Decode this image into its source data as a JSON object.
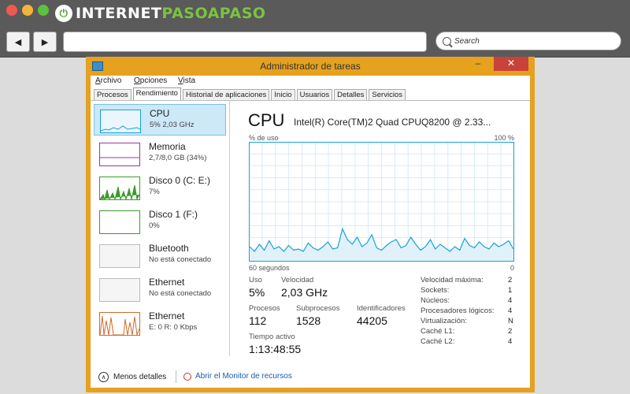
{
  "browser": {
    "brand_prefix": "INTERNET",
    "brand_accent": "PASOAPASO",
    "search_placeholder": "Search",
    "back_glyph": "◀",
    "forward_glyph": "▶"
  },
  "window": {
    "title": "Administrador de tareas",
    "minimize_glyph": "–",
    "close_glyph": "✕"
  },
  "menu": [
    "Archivo",
    "Opciones",
    "Vista"
  ],
  "tabs": [
    "Procesos",
    "Rendimiento",
    "Historial de aplicaciones",
    "Inicio",
    "Usuarios",
    "Detalles",
    "Servicios"
  ],
  "active_tab": "Rendimiento",
  "resources": [
    {
      "name": "CPU",
      "detail": "5% 2,03 GHz",
      "color": "#17a1d6"
    },
    {
      "name": "Memoria",
      "detail": "2,7/8,0 GB (34%)",
      "color": "#a0329a"
    },
    {
      "name": "Disco 0 (C: E:)",
      "detail": "7%",
      "color": "#3a9a2a"
    },
    {
      "name": "Disco 1 (F:)",
      "detail": "0%",
      "color": "#3a9a2a"
    },
    {
      "name": "Bluetooth",
      "detail": "No está conectado",
      "color": "#bbbbbb"
    },
    {
      "name": "Ethernet",
      "detail": "No está conectado",
      "color": "#bbbbbb"
    },
    {
      "name": "Ethernet",
      "detail": "E: 0 R: 0 Kbps",
      "color": "#d16a2a"
    }
  ],
  "cpu_panel": {
    "title": "CPU",
    "model": "Intel(R) Core(TM)2 Quad CPUQ8200 @ 2.33...",
    "graph_ylabel": "% de uso",
    "graph_ymax": "100 %",
    "graph_xlabel": "60 segundos",
    "graph_xmin": "0",
    "usage_samples": [
      12,
      8,
      14,
      9,
      17,
      10,
      12,
      8,
      13,
      9,
      10,
      8,
      15,
      11,
      9,
      12,
      16,
      10,
      11,
      27,
      18,
      14,
      20,
      12,
      15,
      22,
      11,
      9,
      13,
      16,
      18,
      11,
      13,
      20,
      14,
      9,
      12,
      18,
      10,
      14,
      11,
      8,
      12,
      9,
      19,
      13,
      11,
      16,
      12,
      10,
      15,
      12,
      14,
      17,
      10
    ],
    "metrics": [
      {
        "label": "Uso",
        "value": "5%"
      },
      {
        "label": "Velocidad",
        "value": "2,03 GHz"
      },
      {
        "label": "Procesos",
        "value": "112"
      },
      {
        "label": "Subprocesos",
        "value": "1528"
      },
      {
        "label": "Identificadores",
        "value": "44205"
      },
      {
        "label": "Tiempo activo",
        "value": "1:13:48:55"
      }
    ],
    "specs": [
      {
        "label": "Velocidad máxima:",
        "value": "2"
      },
      {
        "label": "Sockets:",
        "value": "1"
      },
      {
        "label": "Núcleos:",
        "value": "4"
      },
      {
        "label": "Procesadores lógicos:",
        "value": "4"
      },
      {
        "label": "Virtualización:",
        "value": "N"
      },
      {
        "label": "Caché L1:",
        "value": "2"
      },
      {
        "label": "Caché L2:",
        "value": "4"
      }
    ]
  },
  "footer": {
    "fewer_details": "Menos detalles",
    "open_monitor": "Abrir el Monitor de recursos"
  },
  "colors": {
    "accent": "#17a1d6",
    "window_frame": "#e6a11f",
    "close": "#c9423a"
  }
}
